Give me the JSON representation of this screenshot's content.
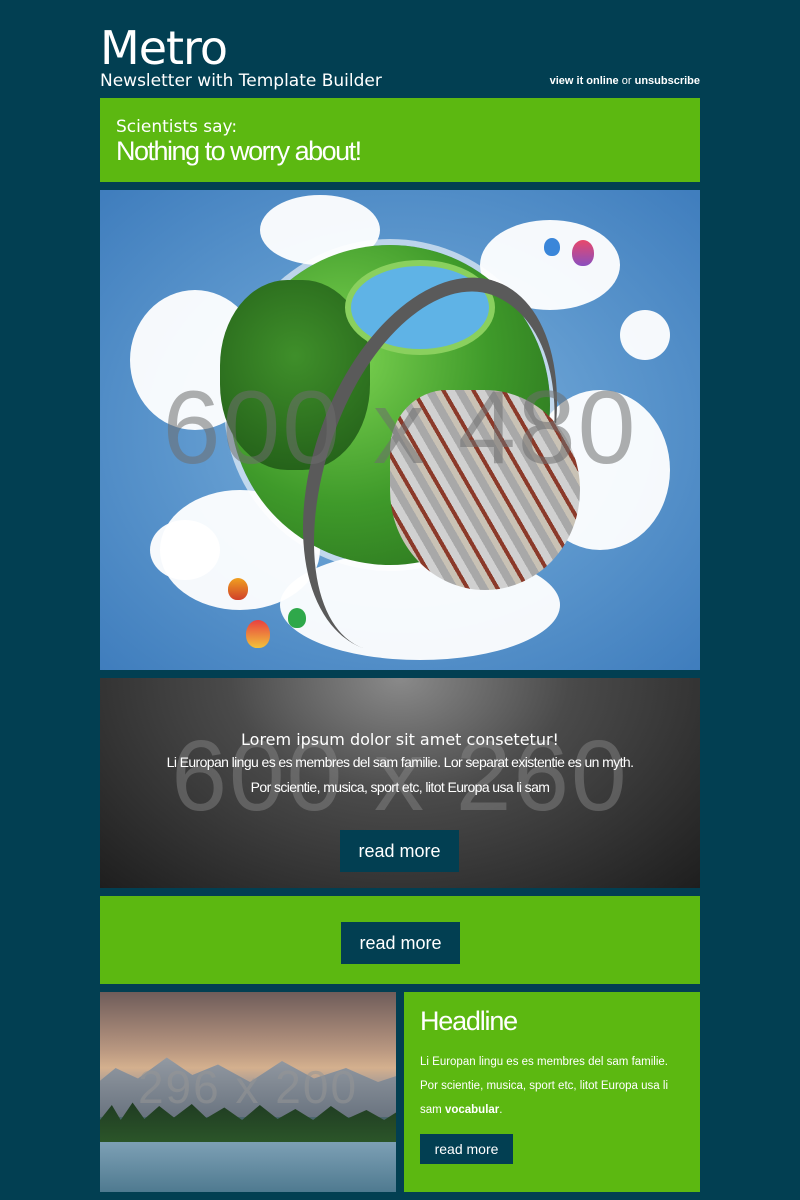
{
  "header": {
    "brand": "Metro",
    "subtitle": "Newsletter with Template Builder",
    "view_online": "view it online",
    "or": "or",
    "unsubscribe": "unsubscribe"
  },
  "intro": {
    "kicker": "Scientists say:",
    "title": "Nothing to worry about!"
  },
  "hero": {
    "watermark": "600 x 480"
  },
  "dark_block": {
    "watermark": "600 x 260",
    "title": "Lorem ipsum dolor sit amet consetetur!",
    "line1": "Li Europan lingu es es membres del sam familie. Lor separat existentie es un myth.",
    "line2": "Por scientie, musica, sport etc, litot Europa usa li sam",
    "button": "read more"
  },
  "cta": {
    "button": "read more"
  },
  "feature": {
    "image_watermark": "296 x 200",
    "headline": "Headline",
    "text1": "Li Europan lingu es es membres del sam familie. Por scientie, musica, sport etc, litot Europa usa li sam",
    "text_bold": "vocabular",
    "text_end": ".",
    "button": "read more"
  },
  "colors": {
    "background": "#023f52",
    "green": "#5cb811",
    "button": "#023f52"
  }
}
